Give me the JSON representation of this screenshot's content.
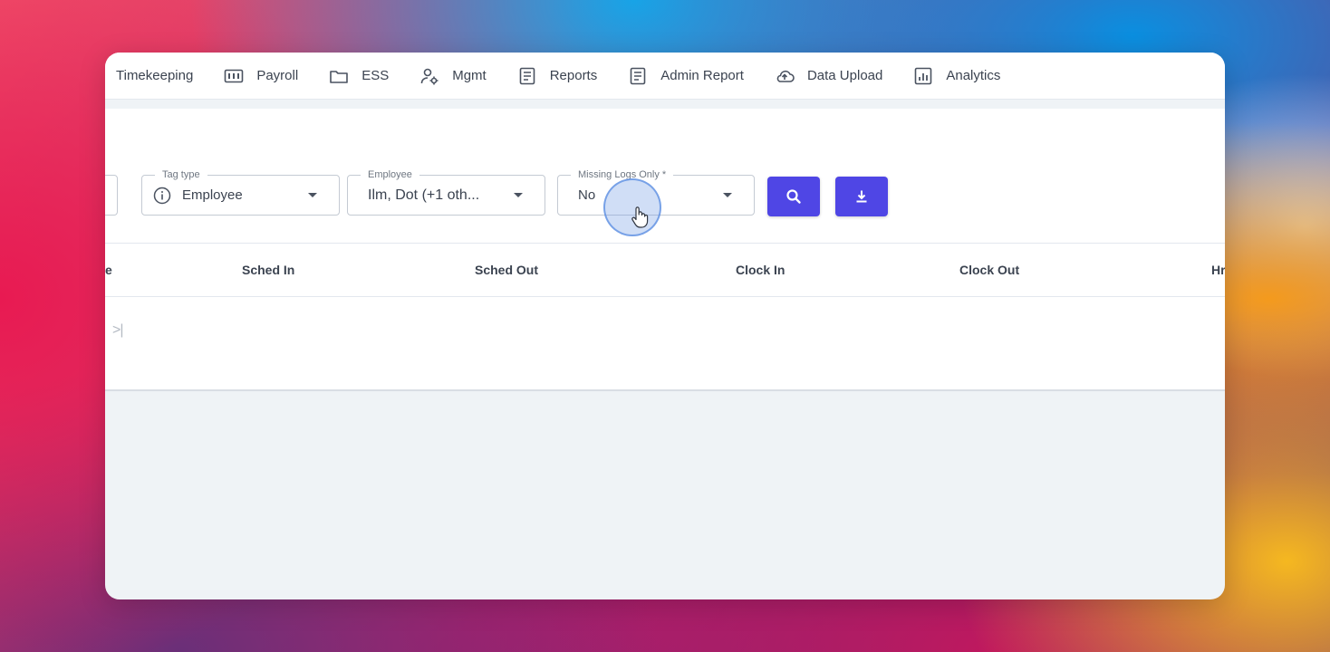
{
  "nav": {
    "items": [
      {
        "label": "Timekeeping",
        "icon": "timekeeping-icon"
      },
      {
        "label": "Payroll",
        "icon": "payroll-icon"
      },
      {
        "label": "ESS",
        "icon": "folder-icon"
      },
      {
        "label": "Mgmt",
        "icon": "user-gear-icon"
      },
      {
        "label": "Reports",
        "icon": "document-icon"
      },
      {
        "label": "Admin Report",
        "icon": "document-icon"
      },
      {
        "label": "Data Upload",
        "icon": "cloud-upload-icon"
      },
      {
        "label": "Analytics",
        "icon": "chart-icon"
      }
    ]
  },
  "filters": {
    "tag_type": {
      "label": "Tag type",
      "value": "Employee"
    },
    "employee": {
      "label": "Employee",
      "value": "Ilm, Dot (+1 oth..."
    },
    "missing_logs": {
      "label": "Missing Logs Only *",
      "value": "No"
    }
  },
  "buttons": {
    "search": "search-icon",
    "download": "download-icon"
  },
  "table": {
    "columns": [
      "e",
      "Sched In",
      "Sched Out",
      "Clock In",
      "Clock Out",
      "Hr"
    ]
  },
  "pager": {
    "last_label": ">|"
  },
  "colors": {
    "primary": "#4f46e5",
    "text": "#3b4350",
    "border": "#c4cad3"
  }
}
